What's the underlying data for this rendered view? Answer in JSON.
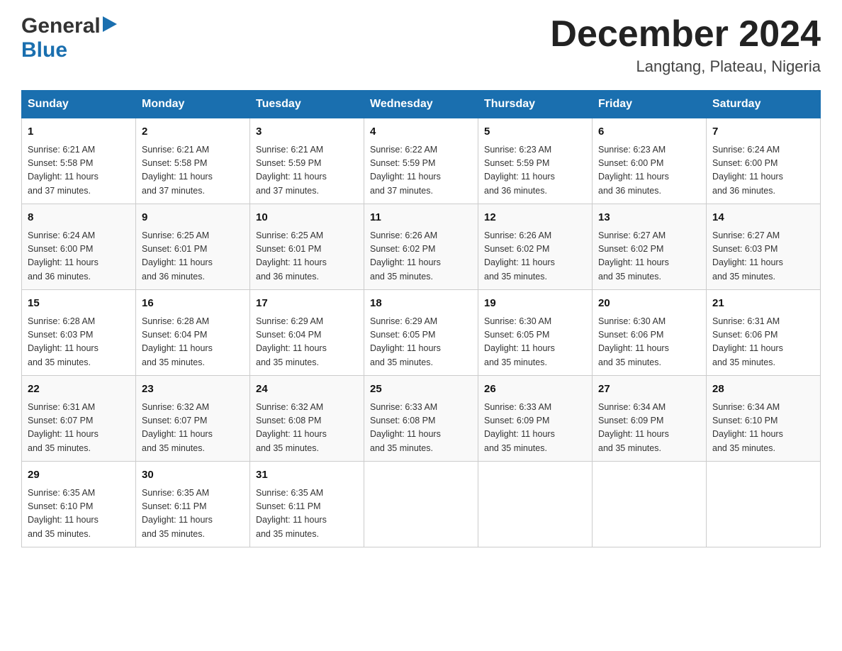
{
  "header": {
    "logo_general": "General",
    "logo_blue": "Blue",
    "title": "December 2024",
    "subtitle": "Langtang, Plateau, Nigeria"
  },
  "days_of_week": [
    "Sunday",
    "Monday",
    "Tuesday",
    "Wednesday",
    "Thursday",
    "Friday",
    "Saturday"
  ],
  "weeks": [
    [
      {
        "day": "1",
        "sunrise": "6:21 AM",
        "sunset": "5:58 PM",
        "daylight": "11 hours and 37 minutes."
      },
      {
        "day": "2",
        "sunrise": "6:21 AM",
        "sunset": "5:58 PM",
        "daylight": "11 hours and 37 minutes."
      },
      {
        "day": "3",
        "sunrise": "6:21 AM",
        "sunset": "5:59 PM",
        "daylight": "11 hours and 37 minutes."
      },
      {
        "day": "4",
        "sunrise": "6:22 AM",
        "sunset": "5:59 PM",
        "daylight": "11 hours and 37 minutes."
      },
      {
        "day": "5",
        "sunrise": "6:23 AM",
        "sunset": "5:59 PM",
        "daylight": "11 hours and 36 minutes."
      },
      {
        "day": "6",
        "sunrise": "6:23 AM",
        "sunset": "6:00 PM",
        "daylight": "11 hours and 36 minutes."
      },
      {
        "day": "7",
        "sunrise": "6:24 AM",
        "sunset": "6:00 PM",
        "daylight": "11 hours and 36 minutes."
      }
    ],
    [
      {
        "day": "8",
        "sunrise": "6:24 AM",
        "sunset": "6:00 PM",
        "daylight": "11 hours and 36 minutes."
      },
      {
        "day": "9",
        "sunrise": "6:25 AM",
        "sunset": "6:01 PM",
        "daylight": "11 hours and 36 minutes."
      },
      {
        "day": "10",
        "sunrise": "6:25 AM",
        "sunset": "6:01 PM",
        "daylight": "11 hours and 36 minutes."
      },
      {
        "day": "11",
        "sunrise": "6:26 AM",
        "sunset": "6:02 PM",
        "daylight": "11 hours and 35 minutes."
      },
      {
        "day": "12",
        "sunrise": "6:26 AM",
        "sunset": "6:02 PM",
        "daylight": "11 hours and 35 minutes."
      },
      {
        "day": "13",
        "sunrise": "6:27 AM",
        "sunset": "6:02 PM",
        "daylight": "11 hours and 35 minutes."
      },
      {
        "day": "14",
        "sunrise": "6:27 AM",
        "sunset": "6:03 PM",
        "daylight": "11 hours and 35 minutes."
      }
    ],
    [
      {
        "day": "15",
        "sunrise": "6:28 AM",
        "sunset": "6:03 PM",
        "daylight": "11 hours and 35 minutes."
      },
      {
        "day": "16",
        "sunrise": "6:28 AM",
        "sunset": "6:04 PM",
        "daylight": "11 hours and 35 minutes."
      },
      {
        "day": "17",
        "sunrise": "6:29 AM",
        "sunset": "6:04 PM",
        "daylight": "11 hours and 35 minutes."
      },
      {
        "day": "18",
        "sunrise": "6:29 AM",
        "sunset": "6:05 PM",
        "daylight": "11 hours and 35 minutes."
      },
      {
        "day": "19",
        "sunrise": "6:30 AM",
        "sunset": "6:05 PM",
        "daylight": "11 hours and 35 minutes."
      },
      {
        "day": "20",
        "sunrise": "6:30 AM",
        "sunset": "6:06 PM",
        "daylight": "11 hours and 35 minutes."
      },
      {
        "day": "21",
        "sunrise": "6:31 AM",
        "sunset": "6:06 PM",
        "daylight": "11 hours and 35 minutes."
      }
    ],
    [
      {
        "day": "22",
        "sunrise": "6:31 AM",
        "sunset": "6:07 PM",
        "daylight": "11 hours and 35 minutes."
      },
      {
        "day": "23",
        "sunrise": "6:32 AM",
        "sunset": "6:07 PM",
        "daylight": "11 hours and 35 minutes."
      },
      {
        "day": "24",
        "sunrise": "6:32 AM",
        "sunset": "6:08 PM",
        "daylight": "11 hours and 35 minutes."
      },
      {
        "day": "25",
        "sunrise": "6:33 AM",
        "sunset": "6:08 PM",
        "daylight": "11 hours and 35 minutes."
      },
      {
        "day": "26",
        "sunrise": "6:33 AM",
        "sunset": "6:09 PM",
        "daylight": "11 hours and 35 minutes."
      },
      {
        "day": "27",
        "sunrise": "6:34 AM",
        "sunset": "6:09 PM",
        "daylight": "11 hours and 35 minutes."
      },
      {
        "day": "28",
        "sunrise": "6:34 AM",
        "sunset": "6:10 PM",
        "daylight": "11 hours and 35 minutes."
      }
    ],
    [
      {
        "day": "29",
        "sunrise": "6:35 AM",
        "sunset": "6:10 PM",
        "daylight": "11 hours and 35 minutes."
      },
      {
        "day": "30",
        "sunrise": "6:35 AM",
        "sunset": "6:11 PM",
        "daylight": "11 hours and 35 minutes."
      },
      {
        "day": "31",
        "sunrise": "6:35 AM",
        "sunset": "6:11 PM",
        "daylight": "11 hours and 35 minutes."
      },
      null,
      null,
      null,
      null
    ]
  ],
  "labels": {
    "sunrise": "Sunrise:",
    "sunset": "Sunset:",
    "daylight": "Daylight:"
  }
}
